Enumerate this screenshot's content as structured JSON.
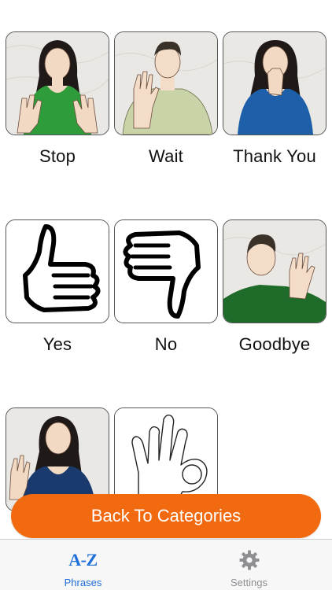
{
  "phrases": [
    {
      "label": "Stop"
    },
    {
      "label": "Wait"
    },
    {
      "label": "Thank You"
    },
    {
      "label": "Yes"
    },
    {
      "label": "No"
    },
    {
      "label": "Goodbye"
    },
    {
      "label": ""
    },
    {
      "label": ""
    }
  ],
  "back_button": {
    "label": "Back To Categories"
  },
  "tabbar": {
    "tabs": [
      {
        "icon_text": "A-Z",
        "label": "Phrases",
        "icon": "az-icon",
        "active": true
      },
      {
        "icon": "gear-icon",
        "label": "Settings",
        "active": false
      }
    ]
  },
  "colors": {
    "accent_orange": "#f26a10",
    "tab_active_blue": "#1e6fd9",
    "tab_inactive_gray": "#8e8e93"
  }
}
